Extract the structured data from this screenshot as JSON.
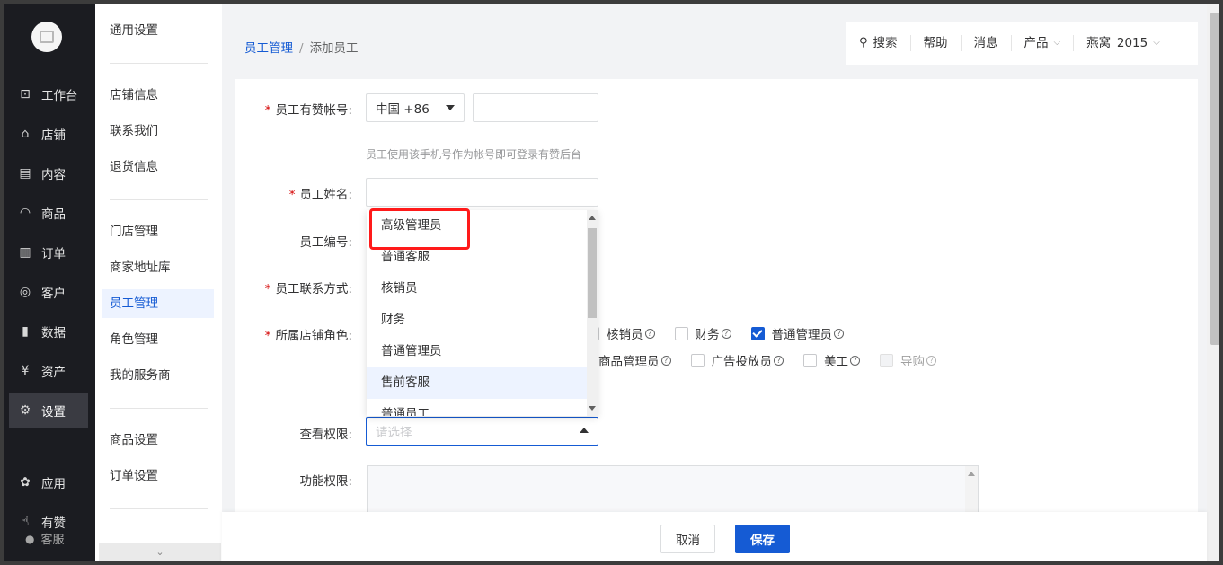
{
  "nav": {
    "items": [
      {
        "label": "工作台",
        "icon": "dashboard-icon",
        "glyph": "⊡"
      },
      {
        "label": "店铺",
        "icon": "store-icon",
        "glyph": "⌂"
      },
      {
        "label": "内容",
        "icon": "content-icon",
        "glyph": "▤"
      },
      {
        "label": "商品",
        "icon": "bag-icon",
        "glyph": "◠"
      },
      {
        "label": "订单",
        "icon": "order-icon",
        "glyph": "▥"
      },
      {
        "label": "客户",
        "icon": "user-icon",
        "glyph": "◎"
      },
      {
        "label": "数据",
        "icon": "chart-icon",
        "glyph": "▮"
      },
      {
        "label": "资产",
        "icon": "yen-icon",
        "glyph": "¥"
      },
      {
        "label": "设置",
        "icon": "gear-icon",
        "glyph": "⚙"
      },
      {
        "label": "应用",
        "icon": "apps-icon",
        "glyph": "✿"
      },
      {
        "label": "有赞",
        "icon": "thumb-icon",
        "glyph": "☝"
      }
    ],
    "active_index": 8,
    "service_label": "客服"
  },
  "subnav": {
    "items": [
      "通用设置",
      "店铺信息",
      "联系我们",
      "退货信息",
      "门店管理",
      "商家地址库",
      "员工管理",
      "角色管理",
      "我的服务商",
      "商品设置",
      "订单设置"
    ],
    "active": "员工管理",
    "collapse_glyph": "⌄"
  },
  "breadcrumb": {
    "parent": "员工管理",
    "current": "添加员工",
    "separator": "/"
  },
  "topbar": {
    "search": "搜索",
    "help": "帮助",
    "messages": "消息",
    "product": "产品",
    "user": "燕窝_2015",
    "chevron": "⌵",
    "search_glyph": "⚲"
  },
  "form": {
    "required_mark": "*",
    "account_label": "员工有赞帐号:",
    "country_code": "中国 +86",
    "account_hint": "员工使用该手机号作为帐号即可登录有赞后台",
    "name_label": "员工姓名:",
    "number_label": "员工编号:",
    "contact_label": "员工联系方式:",
    "role_label": "所属店铺角色:",
    "view_perm_label": "查看权限:",
    "view_perm_placeholder": "请选择",
    "func_perm_label": "功能权限:",
    "help_glyph": "?"
  },
  "roles_row1": [
    {
      "label": "核销员",
      "checked": false,
      "disabled": false
    },
    {
      "label": "财务",
      "checked": false,
      "disabled": false
    },
    {
      "label": "普通管理员",
      "checked": true,
      "disabled": false
    }
  ],
  "roles_row2": [
    {
      "label": "商品管理员",
      "checked": false,
      "disabled": false
    },
    {
      "label": "广告投放员",
      "checked": false,
      "disabled": false
    },
    {
      "label": "美工",
      "checked": false,
      "disabled": false
    },
    {
      "label": "导购",
      "checked": false,
      "disabled": true
    }
  ],
  "dropdown": {
    "options": [
      "高级管理员",
      "普通客服",
      "核销员",
      "财务",
      "普通管理员",
      "售前客服",
      "普通员工"
    ],
    "hover_index": 5,
    "highlighted_index": 0
  },
  "footer": {
    "cancel": "取消",
    "save": "保存"
  },
  "colors": {
    "accent": "#155bd4",
    "nav_bg": "#1b1c21",
    "highlight": "#ff1a1a"
  }
}
